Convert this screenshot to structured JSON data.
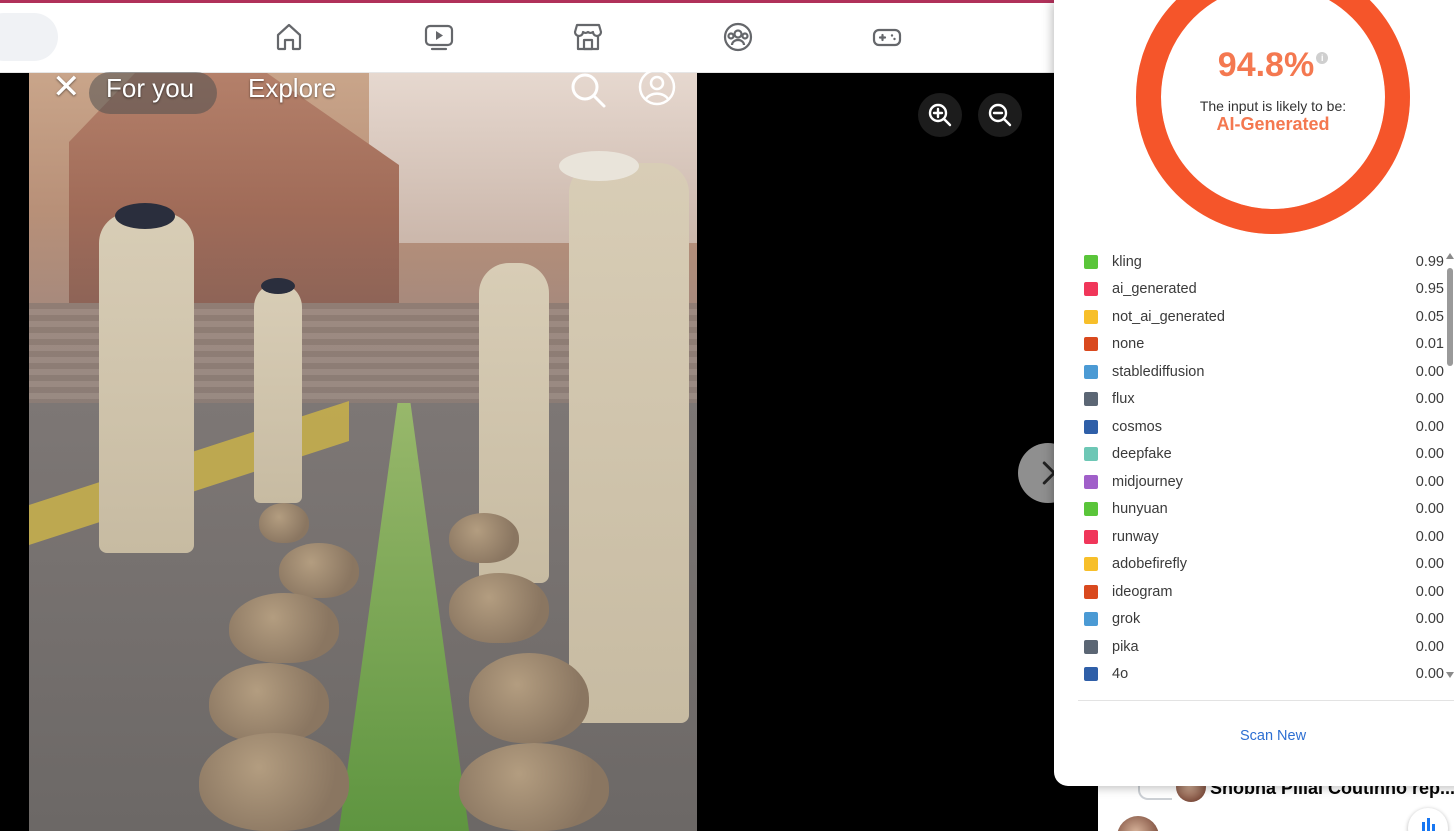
{
  "nav": {
    "icons": [
      "home-icon",
      "video-icon",
      "marketplace-icon",
      "groups-icon",
      "gaming-icon"
    ]
  },
  "video": {
    "tab_foryou": "For you",
    "tab_explore": "Explore"
  },
  "detector": {
    "percent": "94.8%",
    "info": "i",
    "likely_label": "The input is likely to be:",
    "verdict": "AI-Generated",
    "ring_fraction": 0.948,
    "accent_color": "#f5552a",
    "scores": [
      {
        "label": "kling",
        "value": "0.99",
        "color": "#5ac53a"
      },
      {
        "label": "ai_generated",
        "value": "0.95",
        "color": "#f0365a"
      },
      {
        "label": "not_ai_generated",
        "value": "0.05",
        "color": "#f7bf2a"
      },
      {
        "label": "none",
        "value": "0.01",
        "color": "#d9491e"
      },
      {
        "label": "stablediffusion",
        "value": "0.00",
        "color": "#4b9ad4"
      },
      {
        "label": "flux",
        "value": "0.00",
        "color": "#5b6674"
      },
      {
        "label": "cosmos",
        "value": "0.00",
        "color": "#2f5fa8"
      },
      {
        "label": "deepfake",
        "value": "0.00",
        "color": "#6dc7b5"
      },
      {
        "label": "midjourney",
        "value": "0.00",
        "color": "#a05fc9"
      },
      {
        "label": "hunyuan",
        "value": "0.00",
        "color": "#5ac53a"
      },
      {
        "label": "runway",
        "value": "0.00",
        "color": "#f0365a"
      },
      {
        "label": "adobefirefly",
        "value": "0.00",
        "color": "#f7bf2a"
      },
      {
        "label": "ideogram",
        "value": "0.00",
        "color": "#d9491e"
      },
      {
        "label": "grok",
        "value": "0.00",
        "color": "#4b9ad4"
      },
      {
        "label": "pika",
        "value": "0.00",
        "color": "#5b6674"
      },
      {
        "label": "4o",
        "value": "0.00",
        "color": "#2f5fa8"
      }
    ],
    "scan_new": "Scan New"
  },
  "comments": {
    "reply_text": "Shobha Pillai Coutinho rep..."
  }
}
